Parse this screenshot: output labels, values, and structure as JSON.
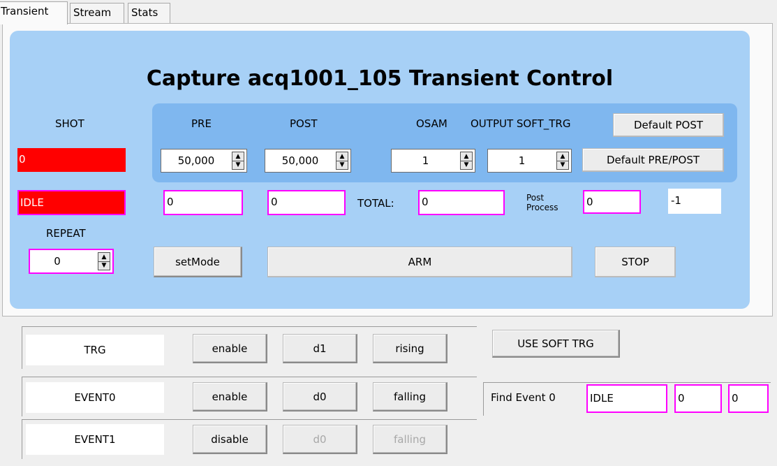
{
  "tabs": [
    "Transient",
    "Stream",
    "Stats"
  ],
  "title": "Capture acq1001_105 Transient  Control",
  "labels": {
    "shot": "SHOT",
    "pre": "PRE",
    "post": "POST",
    "osam": "OSAM",
    "output_soft_trg": "OUTPUT SOFT_TRG",
    "total": "TOTAL:",
    "post_process": "Post\nProcess",
    "repeat": "REPEAT"
  },
  "buttons": {
    "default_post": "Default POST",
    "default_pre_post": "Default PRE/POST",
    "set_mode": "setMode",
    "arm": "ARM",
    "stop": "STOP",
    "use_soft_trg": "USE SOFT TRG"
  },
  "values": {
    "shot": "0",
    "state": "IDLE",
    "pre": "50,000",
    "post": "50,000",
    "osam": "1",
    "output_soft_trg": "1",
    "pre_count": "0",
    "post_count": "0",
    "total": "0",
    "post_process": "0",
    "post_process_extra": "-1",
    "repeat": "0"
  },
  "triggers": [
    {
      "name": "TRG",
      "enable": "enable",
      "dx": "d1",
      "edge": "rising",
      "disabled": false
    },
    {
      "name": "EVENT0",
      "enable": "enable",
      "dx": "d0",
      "edge": "falling",
      "disabled": false
    },
    {
      "name": "EVENT1",
      "enable": "disable",
      "dx": "d0",
      "edge": "falling",
      "disabled": true
    }
  ],
  "find_event": {
    "label": "Find Event 0",
    "state": "IDLE",
    "value1": "0",
    "value2": "0"
  },
  "colors": {
    "panel": "#a7d0f6",
    "inner_panel": "#7fb7ef",
    "status_red": "#ff0000",
    "highlight_magenta": "#ff00ff"
  }
}
